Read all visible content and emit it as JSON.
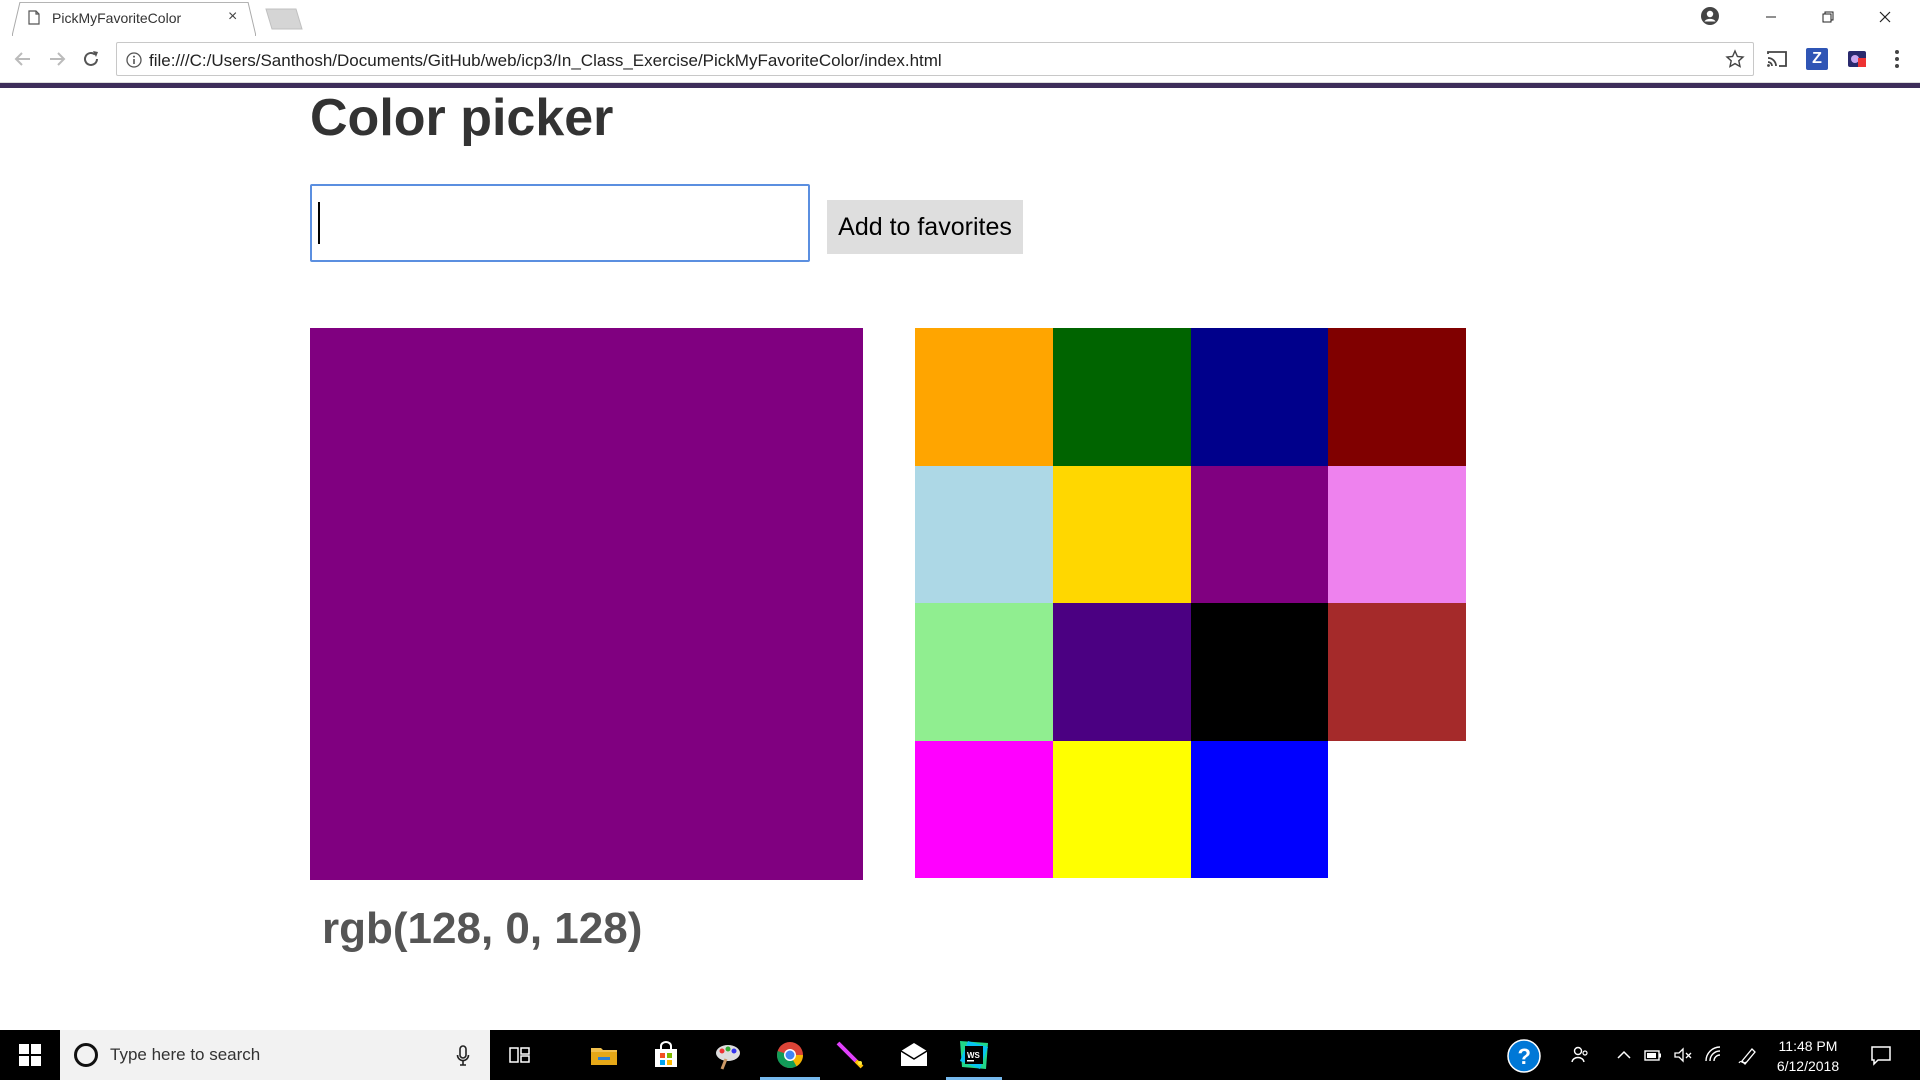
{
  "browser": {
    "tab_title": "PickMyFavoriteColor",
    "tab_close": "×",
    "url": "file:///C:/Users/Santhosh/Documents/GitHub/web/icp3/In_Class_Exercise/PickMyFavoriteColor/index.html",
    "extension_z_label": "Z"
  },
  "page": {
    "title": "Color picker",
    "input_value": "",
    "add_button_label": "Add to favorites",
    "selected_color": "#800080",
    "selected_color_label": "rgb(128, 0, 128)",
    "favorite_colors": [
      "#FFA500",
      "#006400",
      "#00008B",
      "#800000",
      "#ADD8E6",
      "#FFD700",
      "#800080",
      "#EE82EE",
      "#90EE90",
      "#4B0082",
      "#000000",
      "#A52A2A",
      "#FF00FF",
      "#FFFF00",
      "#0000FF"
    ]
  },
  "taskbar": {
    "search_placeholder": "Type here to search",
    "time": "11:48 PM",
    "date": "6/12/2018",
    "pinned_apps": [
      "task-view",
      "file-explorer",
      "store",
      "paint",
      "chrome",
      "pen-app",
      "mail",
      "webstorm"
    ]
  }
}
